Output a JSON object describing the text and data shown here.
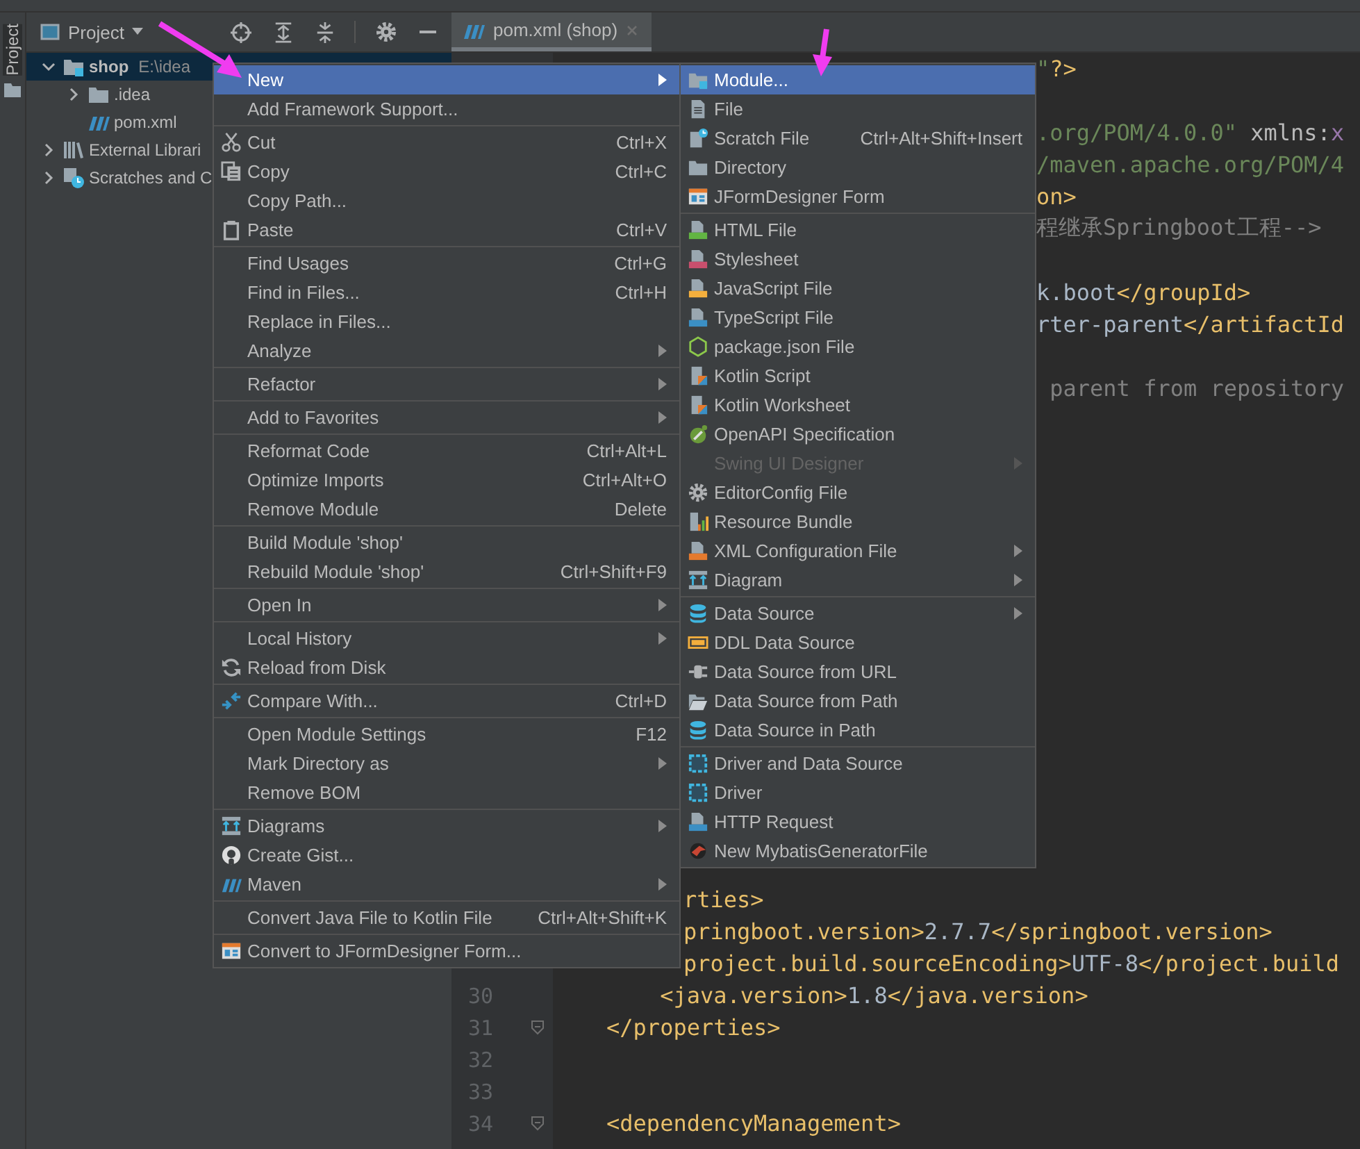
{
  "stripe": {
    "label": "Project"
  },
  "project_panel": {
    "title": "Project",
    "tree": [
      {
        "label": "shop",
        "path": "E:\\idea",
        "kind": "folder",
        "expanded": true,
        "selected": true,
        "children": [
          {
            "label": ".idea",
            "kind": "folder",
            "expanded": false,
            "selected": false
          },
          {
            "label": "pom.xml",
            "kind": "file",
            "expanded": false,
            "selected": false
          }
        ]
      },
      {
        "label": "External Librari",
        "kind": "folder",
        "expanded": false,
        "selected": false
      },
      {
        "label": "Scratches and C",
        "kind": "folder",
        "expanded": false,
        "selected": false
      }
    ]
  },
  "editor": {
    "tabs": [
      {
        "label": "pom.xml (shop)",
        "selected": true
      }
    ],
    "lines": [
      {
        "kind": "right",
        "segments": [
          {
            "t": "\"",
            "kind": "string"
          },
          {
            "t": "?>",
            "kind": "tag"
          }
        ]
      },
      {
        "kind": "blank"
      },
      {
        "kind": "right",
        "segments": [
          {
            "t": ".org/POM/4.0.0\"",
            "kind": "string"
          },
          {
            "t": " xmlns:",
            "kind": "attr"
          },
          {
            "t": "x",
            "kind": "ns"
          }
        ]
      },
      {
        "kind": "right",
        "segments": [
          {
            "t": "/maven.apache.org/POM/4",
            "kind": "string"
          }
        ]
      },
      {
        "kind": "right",
        "segments": [
          {
            "t": "on>",
            "kind": "tag"
          }
        ]
      },
      {
        "kind": "right",
        "segments": [
          {
            "t": "程继承Springboot工程-->",
            "kind": "comment"
          }
        ]
      },
      {
        "kind": "blank"
      },
      {
        "kind": "right",
        "segments": [
          {
            "t": "k.boot",
            "kind": "text"
          },
          {
            "t": "</groupId>",
            "kind": "tag"
          }
        ]
      },
      {
        "kind": "right",
        "segments": [
          {
            "t": "rter-parent",
            "kind": "text"
          },
          {
            "t": "</artifactId",
            "kind": "tag"
          }
        ]
      },
      {
        "kind": "blank"
      },
      {
        "kind": "right",
        "segments": [
          {
            "t": " parent from repository",
            "kind": "comment"
          }
        ]
      },
      {
        "kind": "blank"
      },
      {
        "kind": "blank"
      },
      {
        "kind": "blank"
      },
      {
        "kind": "blank"
      },
      {
        "kind": "blank"
      },
      {
        "kind": "blank"
      },
      {
        "kind": "blank"
      },
      {
        "kind": "blank"
      },
      {
        "kind": "blank"
      },
      {
        "kind": "blank"
      },
      {
        "kind": "blank"
      },
      {
        "kind": "blank"
      },
      {
        "kind": "blank"
      },
      {
        "kind": "blank"
      },
      {
        "kind": "blank"
      },
      {
        "kind": "clipped",
        "segments": [
          {
            "t": "rties>",
            "kind": "tag"
          }
        ]
      },
      {
        "kind": "clipped",
        "segments": [
          {
            "t": "pringboot.version>",
            "kind": "tag"
          },
          {
            "t": "2.7.7",
            "kind": "text"
          },
          {
            "t": "</springboot.version>",
            "kind": "tag"
          }
        ]
      },
      {
        "kind": "clipped",
        "segments": [
          {
            "t": "project.build.sourceEncoding>",
            "kind": "tag"
          },
          {
            "t": "UTF-8",
            "kind": "text"
          },
          {
            "t": "</project.build",
            "kind": "tag"
          }
        ]
      },
      {
        "kind": "full",
        "number": "30",
        "fold": false,
        "segments": [
          {
            "t": "        <java.version>",
            "kind": "tag"
          },
          {
            "t": "1.8",
            "kind": "text"
          },
          {
            "t": "</java.version>",
            "kind": "tag"
          }
        ]
      },
      {
        "kind": "full",
        "number": "31",
        "fold": true,
        "segments": [
          {
            "t": "    </properties>",
            "kind": "tag"
          }
        ]
      },
      {
        "kind": "full",
        "number": "32",
        "fold": false
      },
      {
        "kind": "full",
        "number": "33",
        "fold": false
      },
      {
        "kind": "full",
        "number": "34",
        "fold": true,
        "segments": [
          {
            "t": "    <dependencyManagement>",
            "kind": "tag"
          }
        ]
      }
    ]
  },
  "context_menu": {
    "groups": [
      [
        {
          "label": "New",
          "submenu": true,
          "selected": true,
          "disabled": false
        },
        {
          "label": "Add Framework Support...",
          "submenu": false,
          "selected": false,
          "disabled": false
        }
      ],
      [
        {
          "label": "Cut",
          "shortcut": "Ctrl+X",
          "submenu": false,
          "selected": false,
          "disabled": false
        },
        {
          "label": "Copy",
          "shortcut": "Ctrl+C",
          "submenu": false,
          "selected": false,
          "disabled": false
        },
        {
          "label": "Copy Path...",
          "submenu": false,
          "selected": false,
          "disabled": false
        },
        {
          "label": "Paste",
          "shortcut": "Ctrl+V",
          "submenu": false,
          "selected": false,
          "disabled": false
        }
      ],
      [
        {
          "label": "Find Usages",
          "shortcut": "Ctrl+G",
          "submenu": false,
          "selected": false,
          "disabled": false
        },
        {
          "label": "Find in Files...",
          "shortcut": "Ctrl+H",
          "submenu": false,
          "selected": false,
          "disabled": false
        },
        {
          "label": "Replace in Files...",
          "submenu": false,
          "selected": false,
          "disabled": false
        },
        {
          "label": "Analyze",
          "submenu": true,
          "selected": false,
          "disabled": false
        }
      ],
      [
        {
          "label": "Refactor",
          "submenu": true,
          "selected": false,
          "disabled": false
        }
      ],
      [
        {
          "label": "Add to Favorites",
          "submenu": true,
          "selected": false,
          "disabled": false
        }
      ],
      [
        {
          "label": "Reformat Code",
          "shortcut": "Ctrl+Alt+L",
          "submenu": false,
          "selected": false,
          "disabled": false
        },
        {
          "label": "Optimize Imports",
          "shortcut": "Ctrl+Alt+O",
          "submenu": false,
          "selected": false,
          "disabled": false
        },
        {
          "label": "Remove Module",
          "shortcut": "Delete",
          "submenu": false,
          "selected": false,
          "disabled": false
        }
      ],
      [
        {
          "label": "Build Module 'shop'",
          "submenu": false,
          "selected": false,
          "disabled": false
        },
        {
          "label": "Rebuild Module 'shop'",
          "shortcut": "Ctrl+Shift+F9",
          "submenu": false,
          "selected": false,
          "disabled": false
        }
      ],
      [
        {
          "label": "Open In",
          "submenu": true,
          "selected": false,
          "disabled": false
        }
      ],
      [
        {
          "label": "Local History",
          "submenu": true,
          "selected": false,
          "disabled": false
        },
        {
          "label": "Reload from Disk",
          "submenu": false,
          "selected": false,
          "disabled": false
        }
      ],
      [
        {
          "label": "Compare With...",
          "shortcut": "Ctrl+D",
          "submenu": false,
          "selected": false,
          "disabled": false
        }
      ],
      [
        {
          "label": "Open Module Settings",
          "shortcut": "F12",
          "submenu": false,
          "selected": false,
          "disabled": false
        },
        {
          "label": "Mark Directory as",
          "submenu": true,
          "selected": false,
          "disabled": false
        },
        {
          "label": "Remove BOM",
          "submenu": false,
          "selected": false,
          "disabled": false
        }
      ],
      [
        {
          "label": "Diagrams",
          "submenu": true,
          "selected": false,
          "disabled": false
        },
        {
          "label": "Create Gist...",
          "submenu": false,
          "selected": false,
          "disabled": false
        },
        {
          "label": "Maven",
          "submenu": true,
          "selected": false,
          "disabled": false
        }
      ],
      [
        {
          "label": "Convert Java File to Kotlin File",
          "shortcut": "Ctrl+Alt+Shift+K",
          "submenu": false,
          "selected": false,
          "disabled": false
        }
      ],
      [
        {
          "label": "Convert to JFormDesigner Form...",
          "submenu": false,
          "selected": false,
          "disabled": false
        }
      ]
    ]
  },
  "new_submenu": {
    "groups": [
      [
        {
          "label": "Module...",
          "submenu": false,
          "selected": true,
          "disabled": false
        },
        {
          "label": "File",
          "submenu": false,
          "selected": false,
          "disabled": false
        },
        {
          "label": "Scratch File",
          "shortcut": "Ctrl+Alt+Shift+Insert",
          "submenu": false,
          "selected": false,
          "disabled": false
        },
        {
          "label": "Directory",
          "submenu": false,
          "selected": false,
          "disabled": false
        },
        {
          "label": "JFormDesigner Form",
          "submenu": false,
          "selected": false,
          "disabled": false
        }
      ],
      [
        {
          "label": "HTML File",
          "submenu": false,
          "selected": false,
          "disabled": false
        },
        {
          "label": "Stylesheet",
          "submenu": false,
          "selected": false,
          "disabled": false
        },
        {
          "label": "JavaScript File",
          "submenu": false,
          "selected": false,
          "disabled": false
        },
        {
          "label": "TypeScript File",
          "submenu": false,
          "selected": false,
          "disabled": false
        },
        {
          "label": "package.json File",
          "submenu": false,
          "selected": false,
          "disabled": false
        },
        {
          "label": "Kotlin Script",
          "submenu": false,
          "selected": false,
          "disabled": false
        },
        {
          "label": "Kotlin Worksheet",
          "submenu": false,
          "selected": false,
          "disabled": false
        },
        {
          "label": "OpenAPI Specification",
          "submenu": false,
          "selected": false,
          "disabled": false
        },
        {
          "label": "Swing UI Designer",
          "submenu": true,
          "selected": false,
          "disabled": true
        },
        {
          "label": "EditorConfig File",
          "submenu": false,
          "selected": false,
          "disabled": false
        },
        {
          "label": "Resource Bundle",
          "submenu": false,
          "selected": false,
          "disabled": false
        },
        {
          "label": "XML Configuration File",
          "submenu": true,
          "selected": false,
          "disabled": false
        },
        {
          "label": "Diagram",
          "submenu": true,
          "selected": false,
          "disabled": false
        }
      ],
      [
        {
          "label": "Data Source",
          "submenu": true,
          "selected": false,
          "disabled": false
        },
        {
          "label": "DDL Data Source",
          "submenu": false,
          "selected": false,
          "disabled": false
        },
        {
          "label": "Data Source from URL",
          "submenu": false,
          "selected": false,
          "disabled": false
        },
        {
          "label": "Data Source from Path",
          "submenu": false,
          "selected": false,
          "disabled": false
        },
        {
          "label": "Data Source in Path",
          "submenu": false,
          "selected": false,
          "disabled": false
        }
      ],
      [
        {
          "label": "Driver and Data Source",
          "submenu": false,
          "selected": false,
          "disabled": false
        },
        {
          "label": "Driver",
          "submenu": false,
          "selected": false,
          "disabled": false
        },
        {
          "label": "HTTP Request",
          "submenu": false,
          "selected": false,
          "disabled": false
        },
        {
          "label": "New MybatisGeneratorFile",
          "submenu": false,
          "selected": false,
          "disabled": false
        }
      ]
    ]
  }
}
